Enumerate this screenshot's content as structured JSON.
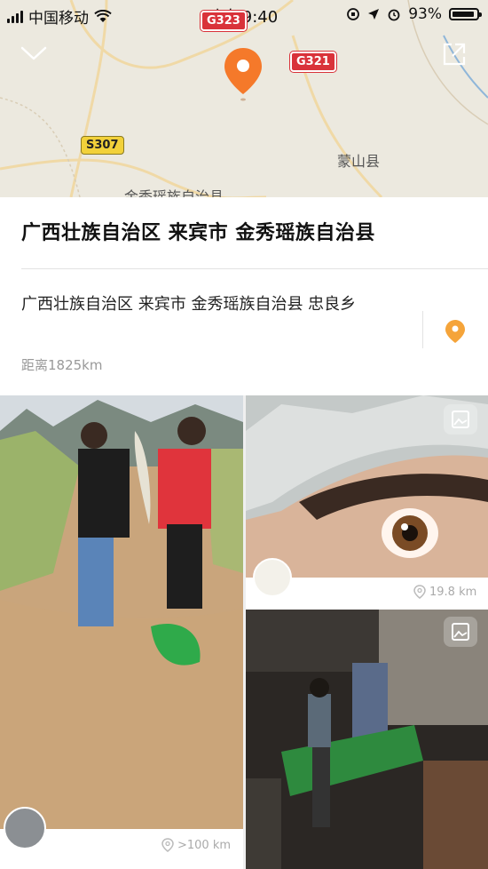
{
  "status_bar": {
    "carrier": "中国移动",
    "time": "上午9:40",
    "battery": "93%"
  },
  "map": {
    "roads": [
      "G323",
      "G321",
      "S307"
    ],
    "places": [
      "蒙山县",
      "金秀瑶族自治县"
    ]
  },
  "header": {
    "title": "广西壮族自治区 来宾市 金秀瑶族自治县"
  },
  "detail": {
    "address": "广西壮族自治区 来宾市 金秀瑶族自治县  忠良乡",
    "distance": "距离1825km"
  },
  "posts": [
    {
      "distance": ">100 km",
      "icon": "location-icon"
    },
    {
      "distance": "19.8 km",
      "icon": "location-icon"
    },
    {
      "distance": "",
      "icon": "image-icon"
    }
  ],
  "colors": {
    "accent": "#f5792a",
    "road_red": "#d9323a",
    "road_yellow": "#f2d13a"
  }
}
